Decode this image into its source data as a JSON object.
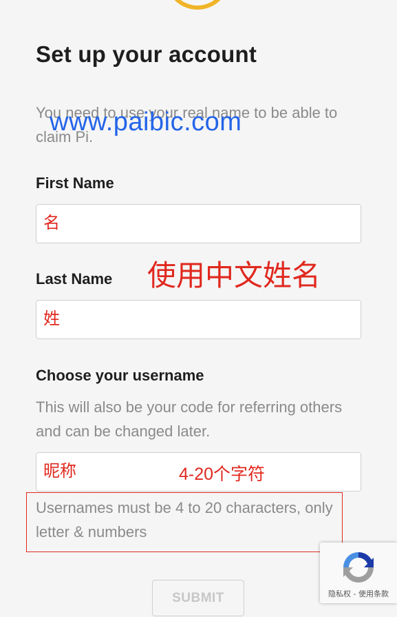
{
  "page": {
    "title": "Set up your account",
    "intro": "You need to use your real name to be able to claim Pi."
  },
  "watermark": "www.paibic.com",
  "form": {
    "first_name": {
      "label": "First Name",
      "value": "名"
    },
    "last_name": {
      "label": "Last Name",
      "value": "姓"
    },
    "username": {
      "label": "Choose your username",
      "description": "This will also be your code for referring others and can be changed later.",
      "value": "昵称",
      "requirement": "Usernames must be 4 to 20 characters, only letter & numbers"
    },
    "submit_label": "SUBMIT"
  },
  "annotations": {
    "use_chinese_name": "使用中文姓名",
    "char_limit": "4-20个字符"
  },
  "recaptcha": {
    "links": "隐私权 - 使用条款"
  },
  "colors": {
    "annotation_red": "#e0281e",
    "watermark_blue": "#2464e8",
    "logo_gold": "#f0b428"
  }
}
